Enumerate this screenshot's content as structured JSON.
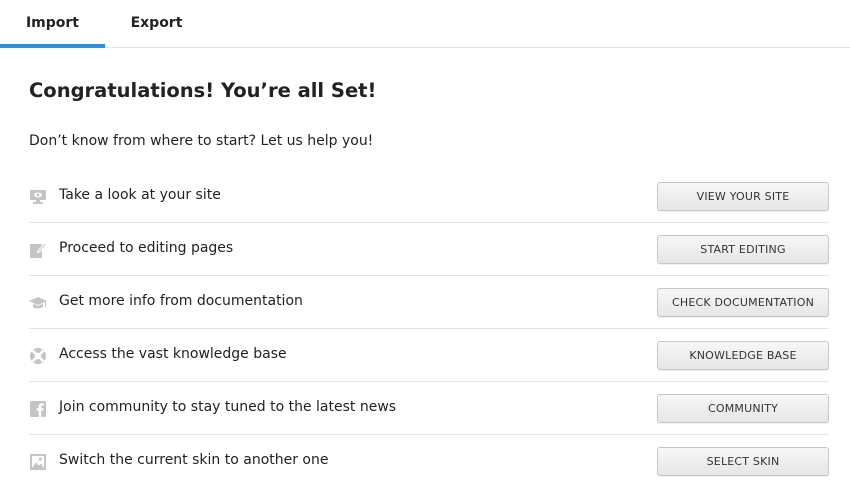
{
  "tabs": {
    "import_label": "Import",
    "export_label": "Export",
    "active": "Import",
    "accent_color": "#2e8fdc"
  },
  "main": {
    "title": "Congratulations! You’re all Set!",
    "subtitle": "Don’t know from where to start? Let us help you!"
  },
  "actions": [
    {
      "icon": "monitor-icon",
      "label": "Take a look at your site",
      "button": "VIEW YOUR SITE"
    },
    {
      "icon": "edit-icon",
      "label": "Proceed to editing pages",
      "button": "START EDITING"
    },
    {
      "icon": "graduation-cap-icon",
      "label": "Get more info from documentation",
      "button": "CHECK DOCUMENTATION"
    },
    {
      "icon": "lifebuoy-icon",
      "label": "Access the vast knowledge base",
      "button": "KNOWLEDGE BASE"
    },
    {
      "icon": "facebook-icon",
      "label": "Join community to stay tuned to the latest news",
      "button": "COMMUNITY"
    },
    {
      "icon": "image-icon",
      "label": "Switch the current skin to another one",
      "button": "SELECT SKIN"
    }
  ]
}
